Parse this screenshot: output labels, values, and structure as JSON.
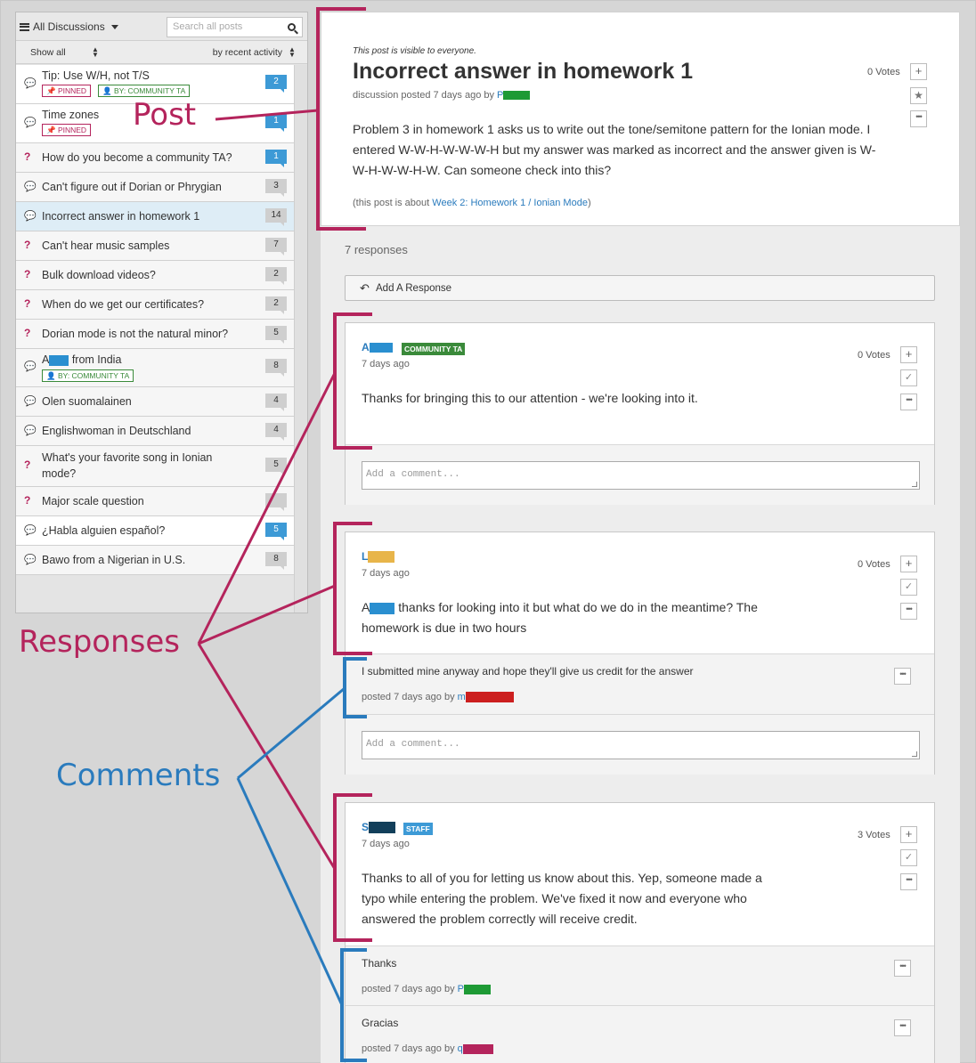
{
  "colors": {
    "accent_blue": "#2a7bbd",
    "pink": "#b4245c",
    "count_blue": "#3d9ad6",
    "ta_green": "#3a8a3a"
  },
  "sidebar": {
    "menu_label": "All Discussions",
    "search_placeholder": "Search all posts",
    "filter_show": "Show all",
    "filter_sort": "by recent activity",
    "items": [
      {
        "icon": "chat-bubble-icon",
        "title": "Tip: Use W/H, not T/S",
        "count": "2",
        "tags": [
          "PINNED",
          "BY: COMMUNITY TA"
        ]
      },
      {
        "icon": "chat-bubble-icon",
        "title": "Time zones",
        "count": "1",
        "tags": [
          "PINNED"
        ]
      },
      {
        "icon": "question-icon",
        "title": "How do you become a community TA?",
        "count": "1"
      },
      {
        "icon": "chat-bubble-icon",
        "title": "Can't figure out if Dorian or Phrygian",
        "count": "3"
      },
      {
        "icon": "chat-bubble-icon",
        "title": "Incorrect answer in homework 1",
        "count": "14"
      },
      {
        "icon": "question-icon",
        "title": "Can't hear music samples",
        "count": "7"
      },
      {
        "icon": "question-icon",
        "title": "Bulk download videos?",
        "count": "2"
      },
      {
        "icon": "question-icon",
        "title": "When do we get our certificates?",
        "count": "2"
      },
      {
        "icon": "question-icon",
        "title": "Dorian mode is not the natural minor?",
        "count": "5"
      },
      {
        "icon": "chat-bubble-icon",
        "title_prefix": "A",
        "title_suffix": " from India",
        "count": "8",
        "tags": [
          "BY: COMMUNITY TA"
        ]
      },
      {
        "icon": "chat-bubble-icon",
        "title": "Olen suomalainen",
        "count": "4"
      },
      {
        "icon": "chat-bubble-icon",
        "title": "Englishwoman in Deutschland",
        "count": "4"
      },
      {
        "icon": "question-icon",
        "title": "What's your favorite song in Ionian mode?",
        "count": "5"
      },
      {
        "icon": "question-icon",
        "title": "Major scale question",
        "count": ""
      },
      {
        "icon": "chat-bubble-icon",
        "title": "¿Habla alguien español?",
        "count": "5"
      },
      {
        "icon": "chat-bubble-icon",
        "title": "Bawo from a Nigerian in U.S.",
        "count": "8"
      }
    ]
  },
  "post": {
    "visibility": "This post is visible to everyone.",
    "title": "Incorrect answer in homework 1",
    "meta_prefix": "discussion posted 7 days ago by ",
    "author_initial": "P",
    "votes": "0 Votes",
    "body": "Problem 3 in homework 1 asks us to write out the tone/semitone pattern for the Ionian mode. I entered W-W-H-W-W-W-H but my answer was marked as incorrect and the answer given is W-W-H-W-W-H-W. Can someone check into this?",
    "about_prefix": "(this post is about ",
    "about_link": "Week 2: Homework 1 / Ionian Mode",
    "about_suffix": ")"
  },
  "responses_count": "7 responses",
  "add_response_label": "Add A Response",
  "comment_placeholder": "Add a comment...",
  "responses": [
    {
      "author_initial": "A",
      "badge": "COMMUNITY TA",
      "when": "7 days ago",
      "votes": "0 Votes",
      "body": "Thanks for bringing this to our attention - we're looking into it.",
      "comments": []
    },
    {
      "author_initial": "L",
      "when": "7 days ago",
      "votes": "0 Votes",
      "body_prefix": "A",
      "body": " thanks for looking into it but what do we do in  the meantime? The homework is due in two hours",
      "comments": [
        {
          "text": "I submitted mine anyway and hope they'll give us credit for the answer",
          "meta": "posted 7 days ago by ",
          "author_initial": "m"
        }
      ]
    },
    {
      "author_initial": "S",
      "badge": "STAFF",
      "when": "7 days ago",
      "votes": "3 Votes",
      "body": "Thanks to all of you for letting us know about this. Yep, someone made a typo while entering the problem. We've fixed it now and everyone who answered the problem correctly will receive credit.",
      "comments": [
        {
          "text": "Thanks",
          "meta": "posted 7 days ago by ",
          "author_initial": "P"
        },
        {
          "text": "Gracias",
          "meta": "posted 7 days ago by ",
          "author_initial": "q"
        }
      ]
    }
  ],
  "annotations": {
    "post": "Post",
    "responses": "Responses",
    "comments": "Comments"
  }
}
